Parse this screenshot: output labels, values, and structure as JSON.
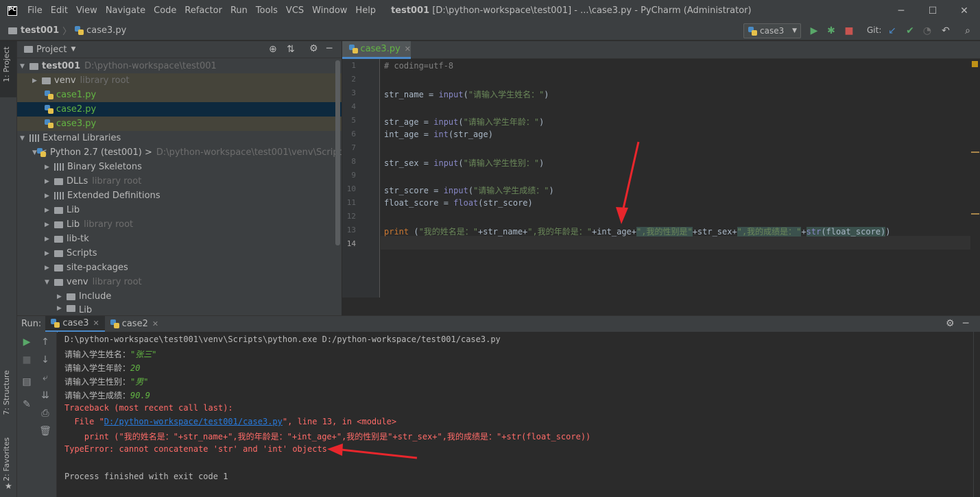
{
  "titlebar": {
    "menus": [
      "File",
      "Edit",
      "View",
      "Navigate",
      "Code",
      "Refactor",
      "Run",
      "Tools",
      "VCS",
      "Window",
      "Help"
    ],
    "title_bold": "test001",
    "title_rest": "[D:\\python-workspace\\test001] - ...\\case3.py - PyCharm (Administrator)"
  },
  "navbar": {
    "project": "test001",
    "file": "case3.py",
    "run_config": "case3",
    "git_label": "Git:"
  },
  "left_stripe": {
    "project_tab": "1: Project",
    "structure_tab": "7: Structure",
    "favorites_tab": "2: Favorites"
  },
  "project_panel": {
    "title": "Project",
    "tree": [
      {
        "label": "test001",
        "extra": "D:\\python-workspace\\test001"
      },
      {
        "label": "venv",
        "extra": "library root"
      },
      {
        "label": "case1.py"
      },
      {
        "label": "case2.py"
      },
      {
        "label": "case3.py"
      },
      {
        "label": "External Libraries"
      },
      {
        "label": "< Python 2.7 (test001) >",
        "extra": "D:\\python-workspace\\test001\\venv\\Scripts\\pyt"
      },
      {
        "label": "Binary Skeletons"
      },
      {
        "label": "DLLs",
        "extra": "library root"
      },
      {
        "label": "Extended Definitions"
      },
      {
        "label": "Lib"
      },
      {
        "label": "Lib",
        "extra": "library root"
      },
      {
        "label": "lib-tk"
      },
      {
        "label": "Scripts"
      },
      {
        "label": "site-packages"
      },
      {
        "label": "venv",
        "extra": "library root"
      },
      {
        "label": "Include"
      },
      {
        "label": "Lib"
      }
    ]
  },
  "editor": {
    "tab": "case3.py",
    "line_numbers": [
      "1",
      "2",
      "3",
      "4",
      "5",
      "6",
      "7",
      "8",
      "9",
      "10",
      "11",
      "12",
      "13",
      "14"
    ],
    "code": {
      "l1": "# coding=utf-8",
      "l3a": "str_name = ",
      "l3b": "input",
      "l3c": "(",
      "l3d": "\"请输入学生姓名：\"",
      "l3e": ")",
      "l5a": "str_age = ",
      "l5b": "input",
      "l5c": "(",
      "l5d": "\"请输入学生年龄：\"",
      "l5e": ")",
      "l6a": "int_age = ",
      "l6b": "int",
      "l6c": "(str_age)",
      "l8a": "str_sex = ",
      "l8b": "input",
      "l8c": "(",
      "l8d": "\"请输入学生性别：\"",
      "l8e": ")",
      "l10a": "str_score = ",
      "l10b": "input",
      "l10c": "(",
      "l10d": "\"请输入学生成绩：\"",
      "l10e": ")",
      "l11a": "float_score = ",
      "l11b": "float",
      "l11c": "(str_score)",
      "l13a": "print",
      "l13b": " (",
      "l13c": "\"我的姓名是：\"",
      "l13d": "+str_name+",
      "l13e": "\",我的年龄是：\"",
      "l13f": "+int_age+",
      "l13g": "\",我的性别是\"",
      "l13h": "+str_sex+",
      "l13i": "\",我的成绩是：\"",
      "l13j": "+",
      "l13k": "str",
      "l13l": "(float_score)",
      "l13m": ")"
    }
  },
  "run_panel": {
    "label": "Run:",
    "tabs": [
      "case3",
      "case2"
    ],
    "console": {
      "cmd": "D:\\python-workspace\\test001\\venv\\Scripts\\python.exe D:/python-workspace/test001/case3.py",
      "p1": "请输入学生姓名：",
      "v1": "\"张三\"",
      "p2": "请输入学生年龄：",
      "v2": "20",
      "p3": "请输入学生性别：",
      "v3": "\"男\"",
      "p4": "请输入学生成绩：",
      "v4": "90.9",
      "tb": "Traceback (most recent call last):",
      "file_pre": "  File \"",
      "file_link": "D:/python-workspace/test001/case3.py",
      "file_post": "\", line 13, in <module>",
      "src": "    print (\"我的姓名是：\"+str_name+\",我的年龄是：\"+int_age+\",我的性别是\"+str_sex+\",我的成绩是：\"+str(float_score))",
      "error": "TypeError: cannot concatenate 'str' and 'int' objects",
      "exit": "Process finished with exit code 1"
    }
  },
  "colors": {
    "annotation_arrow": "#e8262c",
    "background": "#2b2b2b",
    "accent": "#4a88c7"
  }
}
